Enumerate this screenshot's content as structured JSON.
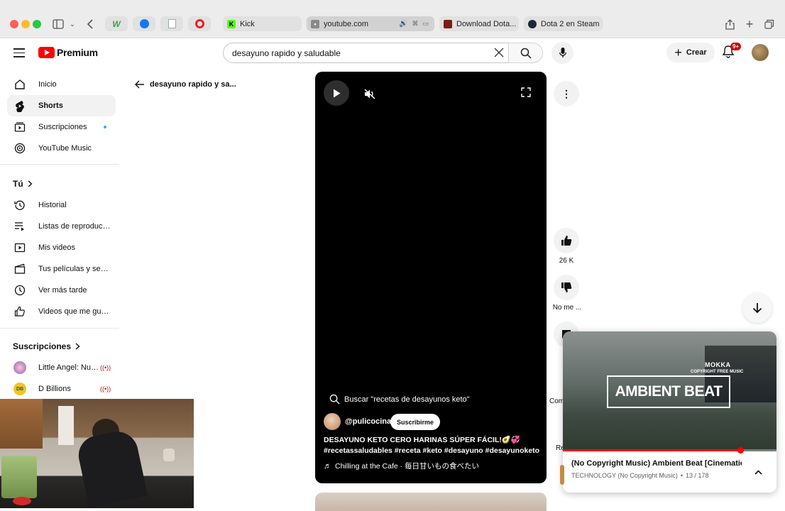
{
  "browser": {
    "tabs": [
      {
        "label": "Kick",
        "icon": "kick-icon",
        "color": "#53fc18"
      },
      {
        "label": "youtube.com",
        "icon": "youtube-tab-icon",
        "color": "#888888"
      },
      {
        "label": "Download Dota...",
        "icon": "dota-icon",
        "color": "#7a1d14"
      },
      {
        "label": "Dota 2 en Steam",
        "icon": "steam-icon",
        "color": "#1b2838"
      }
    ],
    "pinned_tabs": [
      "whatsapp-icon",
      "facebook-icon",
      "docs-icon",
      "blocked-icon"
    ]
  },
  "header": {
    "logo_text": "Premium",
    "search_value": "desayuno rapido y saludable",
    "create_label": "Crear",
    "notification_count": "9+",
    "brand_color": "#ff0000"
  },
  "sidebar": {
    "main": [
      {
        "label": "Inicio",
        "icon": "home-icon"
      },
      {
        "label": "Shorts",
        "icon": "shorts-icon"
      },
      {
        "label": "Suscripciones",
        "icon": "subscriptions-icon"
      },
      {
        "label": "YouTube Music",
        "icon": "music-icon"
      }
    ],
    "you_title": "Tú",
    "you": [
      {
        "label": "Historial",
        "icon": "history-icon"
      },
      {
        "label": "Listas de reproducc...",
        "icon": "playlist-icon"
      },
      {
        "label": "Mis videos",
        "icon": "my-videos-icon"
      },
      {
        "label": "Tus películas y seri...",
        "icon": "movies-icon"
      },
      {
        "label": "Ver más tarde",
        "icon": "watch-later-icon"
      },
      {
        "label": "Videos que me gus...",
        "icon": "liked-icon"
      }
    ],
    "subs_title": "Suscripciones",
    "subs": [
      {
        "label": "Little Angel: Nurs...",
        "icon": "little-angel-avatar"
      },
      {
        "label": "D Billions",
        "icon": "d-billions-avatar",
        "avatar_text": "DB"
      }
    ]
  },
  "back_title": "desayuno rapido y sa...",
  "short": {
    "search_suggestion": "Buscar \"recetas de desayunos keto\"",
    "channel": "@pulicocina",
    "subscribe_label": "Suscribirme",
    "title": "DESAYUNO KETO CERO HARINAS SÚPER FÁCIL!🥑💞",
    "hashtags": "#recetassaludables #receta #keto #desayuno #desayunoketo",
    "music": "Chilling at the Cafe · 毎日甘いもの食べたい"
  },
  "actions": {
    "likes": "26 K",
    "dislike_label": "No me ...",
    "comments_partial": "Com",
    "remix_partial": "Re"
  },
  "mini_player": {
    "thumb_brand": "MOKKA",
    "thumb_sub": "COPYRIGHT FREE MUSIC",
    "thumb_title": "AMBIENT BEAT",
    "title": "(No Copyright Music) Ambient Beat [Cinematic ...",
    "channel": "TECHNOLOGY (No Copyright Music)",
    "position": "13 / 178",
    "progress": 0.83
  }
}
